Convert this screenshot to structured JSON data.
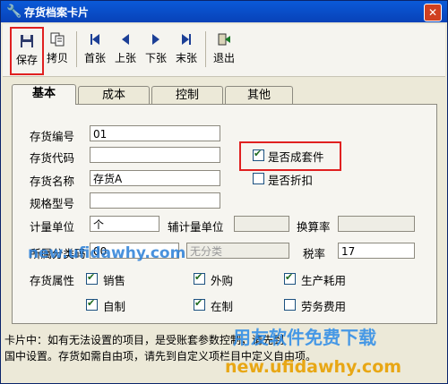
{
  "window": {
    "title": "存货档案卡片",
    "close_glyph": "✕"
  },
  "toolbar": {
    "buttons": [
      {
        "id": "save",
        "label": "保存"
      },
      {
        "id": "copy",
        "label": "拷贝"
      },
      {
        "id": "first",
        "label": "首张"
      },
      {
        "id": "prev",
        "label": "上张"
      },
      {
        "id": "next",
        "label": "下张"
      },
      {
        "id": "last",
        "label": "末张"
      },
      {
        "id": "exit",
        "label": "退出"
      }
    ]
  },
  "tabs": [
    {
      "label": "基本",
      "active": true
    },
    {
      "label": "成本",
      "active": false
    },
    {
      "label": "控制",
      "active": false
    },
    {
      "label": "其他",
      "active": false
    }
  ],
  "form": {
    "code_label": "存货编号",
    "code_value": "01",
    "daicode_label": "存货代码",
    "daicode_value": "",
    "name_label": "存货名称",
    "name_value": "存货A",
    "spec_label": "规格型号",
    "spec_value": "",
    "unit_label": "计量单位",
    "unit_value": "个",
    "aux_unit_label": "辅计量单位",
    "aux_unit_value": "",
    "rate_label": "换算率",
    "rate_value": "",
    "category_label": "所属分类码",
    "category_value": "00",
    "category_name_value": "无分类",
    "tax_label": "税率",
    "tax_value": "17",
    "attr_label": "存货属性",
    "is_kit_label": "是否成套件",
    "is_kit_checked": true,
    "is_discount_label": "是否折扣",
    "is_discount_checked": false,
    "attrs": [
      {
        "label": "销售",
        "checked": true
      },
      {
        "label": "外购",
        "checked": true
      },
      {
        "label": "生产耗用",
        "checked": true
      },
      {
        "label": "自制",
        "checked": true
      },
      {
        "label": "在制",
        "checked": true
      },
      {
        "label": "劳务费用",
        "checked": false
      }
    ]
  },
  "footer": {
    "line1": "卡片中：如有无法设置的项目，是受账套参数控制，请先到",
    "line2": "国中设置。存货如需自由项，请先到自定义项栏目中定义自由项。"
  },
  "watermarks": {
    "url1": "new.ufidawhy.com",
    "brand": "用友软件免费下载",
    "url2": "new.ufidawhy.com"
  },
  "colors": {
    "title_bar": "#0a5ad8",
    "highlight_red": "#e02020",
    "panel_bg": "#f6f5f0"
  }
}
